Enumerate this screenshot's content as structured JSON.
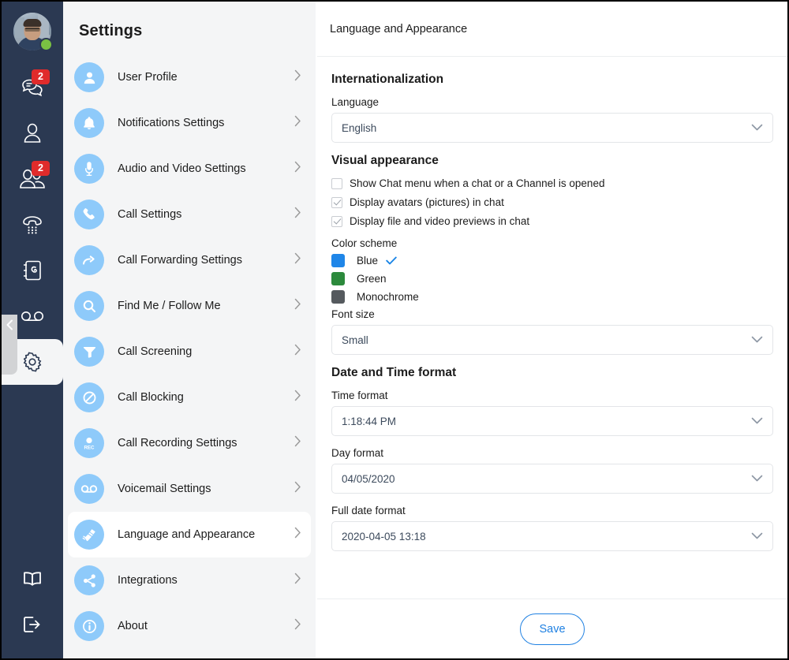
{
  "rail": {
    "avatar_name": "user-avatar",
    "status": "online",
    "items": [
      {
        "icon": "chat-icon",
        "badge": "2"
      },
      {
        "icon": "contact-icon",
        "badge": ""
      },
      {
        "icon": "contacts-group-icon",
        "badge": "2"
      },
      {
        "icon": "dialpad-phone-icon",
        "badge": ""
      },
      {
        "icon": "address-book-icon",
        "badge": ""
      },
      {
        "icon": "voicemail-icon",
        "badge": ""
      },
      {
        "icon": "gear-icon",
        "badge": ""
      }
    ],
    "bottom_items": [
      {
        "icon": "book-icon"
      },
      {
        "icon": "logout-icon"
      }
    ],
    "collapse_icon": "chevron-left-icon"
  },
  "settings": {
    "title": "Settings",
    "items": [
      {
        "label": "User Profile",
        "icon": "person-icon"
      },
      {
        "label": "Notifications Settings",
        "icon": "bell-icon"
      },
      {
        "label": "Audio and Video Settings",
        "icon": "microphone-icon"
      },
      {
        "label": "Call Settings",
        "icon": "phone-icon"
      },
      {
        "label": "Call Forwarding Settings",
        "icon": "arrow-forward-icon"
      },
      {
        "label": "Find Me / Follow Me",
        "icon": "magnifier-icon"
      },
      {
        "label": "Call Screening",
        "icon": "funnel-icon"
      },
      {
        "label": "Call Blocking",
        "icon": "block-icon"
      },
      {
        "label": "Call Recording Settings",
        "icon": "record-icon"
      },
      {
        "label": "Voicemail Settings",
        "icon": "voicemail-icon"
      },
      {
        "label": "Language and Appearance",
        "icon": "brush-icon"
      },
      {
        "label": "Integrations",
        "icon": "share-icon"
      },
      {
        "label": "About",
        "icon": "info-icon"
      }
    ],
    "active_index": 10,
    "chevron_icon": "chevron-right-icon"
  },
  "main": {
    "header_title": "Language and Appearance",
    "internationalization": {
      "title": "Internationalization",
      "language_label": "Language",
      "language_value": "English"
    },
    "visual_appearance": {
      "title": "Visual appearance",
      "checkboxes": [
        {
          "label": "Show Chat menu when a chat or a Channel is opened",
          "checked": false
        },
        {
          "label": "Display avatars (pictures) in chat",
          "checked": true
        },
        {
          "label": "Display file and video previews in chat",
          "checked": true
        }
      ],
      "color_scheme_label": "Color scheme",
      "color_schemes": [
        {
          "label": "Blue",
          "color": "#1f86e8",
          "selected": true
        },
        {
          "label": "Green",
          "color": "#2c8a3c",
          "selected": false
        },
        {
          "label": "Monochrome",
          "color": "#555a5e",
          "selected": false
        }
      ],
      "font_size_label": "Font size",
      "font_size_value": "Small"
    },
    "date_time": {
      "title": "Date and Time format",
      "time_format_label": "Time format",
      "time_format_value": "1:18:44 PM",
      "day_format_label": "Day format",
      "day_format_value": "04/05/2020",
      "full_date_format_label": "Full date format",
      "full_date_format_value": "2020-04-05 13:18"
    },
    "save_label": "Save"
  },
  "colors": {
    "rail_bg": "#2b3952",
    "panel_bg": "#f4f5f6",
    "accent_blue": "#2081e2",
    "icon_circle": "#8ecafa",
    "badge_red": "#e02b2b",
    "status_green": "#7ac143"
  }
}
